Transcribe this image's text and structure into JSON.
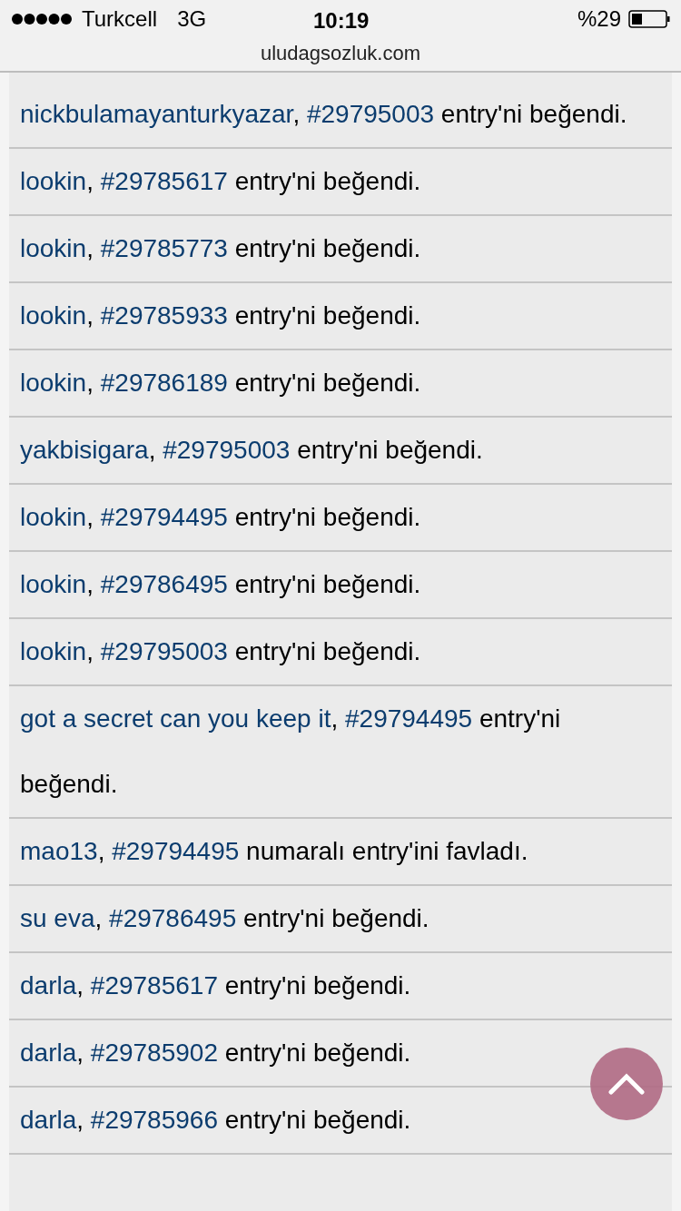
{
  "status_bar": {
    "carrier": "Turkcell",
    "network": "3G",
    "time": "10:19",
    "battery": "%29"
  },
  "address_bar": {
    "url": "uludagsozluk.com"
  },
  "notifications": [
    {
      "user": "nickbulamayanturkyazar",
      "punct": ",",
      "entry": "#29795003",
      "text": "entry'ni beğendi."
    },
    {
      "user": "lookin",
      "punct": ",",
      "entry": "#29785617",
      "text": "entry'ni beğendi."
    },
    {
      "user": "lookin",
      "punct": ",",
      "entry": "#29785773",
      "text": "entry'ni beğendi."
    },
    {
      "user": "lookin",
      "punct": ",",
      "entry": "#29785933",
      "text": "entry'ni beğendi."
    },
    {
      "user": "lookin",
      "punct": ",",
      "entry": "#29786189",
      "text": "entry'ni beğendi."
    },
    {
      "user": "yakbisigara",
      "punct": ",",
      "entry": "#29795003",
      "text": "entry'ni beğendi."
    },
    {
      "user": "lookin",
      "punct": ",",
      "entry": "#29794495",
      "text": "entry'ni beğendi."
    },
    {
      "user": "lookin",
      "punct": ",",
      "entry": "#29786495",
      "text": "entry'ni beğendi."
    },
    {
      "user": "lookin",
      "punct": ",",
      "entry": "#29795003",
      "text": "entry'ni beğendi."
    },
    {
      "user": "got a secret can you keep it",
      "punct": ",",
      "entry": "#29794495",
      "text": "entry'ni beğendi."
    },
    {
      "user": "mao13",
      "punct": ",",
      "entry": "#29794495",
      "text": "numaralı entry'ini favladı."
    },
    {
      "user": "su eva",
      "punct": ",",
      "entry": "#29786495",
      "text": "entry'ni beğendi."
    },
    {
      "user": "darla",
      "punct": ",",
      "entry": "#29785617",
      "text": "entry'ni beğendi."
    },
    {
      "user": "darla",
      "punct": ",",
      "entry": "#29785902",
      "text": "entry'ni beğendi."
    },
    {
      "user": "darla",
      "punct": ",",
      "entry": "#29785966",
      "text": "entry'ni beğendi."
    }
  ]
}
